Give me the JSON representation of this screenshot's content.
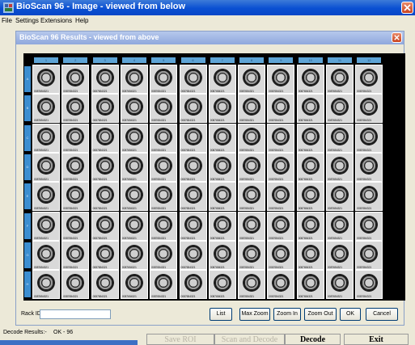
{
  "window": {
    "title": "BioScan 96 - Image - viewed from below",
    "close_label": "close"
  },
  "menu": [
    "File",
    "Settings",
    "Extensions",
    "Help"
  ],
  "results_panel": {
    "title": "BioScan 96 Results - viewed from above"
  },
  "grid": {
    "columns": [
      "1",
      "2",
      "3",
      "4",
      "5",
      "6",
      "7",
      "8",
      "9",
      "10",
      "11",
      "12"
    ],
    "rows": [
      "A",
      "B",
      "C",
      "D",
      "E",
      "F",
      "G",
      "H"
    ],
    "cell_code": "0087654321"
  },
  "controls": {
    "rack_id_label": "Rack ID:",
    "rack_id_value": "",
    "buttons": [
      "List",
      "Max Zoom",
      "Zoom In",
      "Zoom Out",
      "OK",
      "Cancel"
    ]
  },
  "status": {
    "decode_results_label": "Decode Results:-",
    "decode_results_value": "OK - 96"
  },
  "actions": {
    "save_roi": "Save ROI",
    "scan_and_decode": "Scan and Decode",
    "decode": "Decode",
    "exit": "Exit"
  },
  "colors": {
    "title_bar": "#0a4fd2",
    "inner_title_bar": "#9db3e3",
    "column_header": "#5ea4d6",
    "row_header": "#3c8ed0",
    "close_button": "#d4532c"
  }
}
